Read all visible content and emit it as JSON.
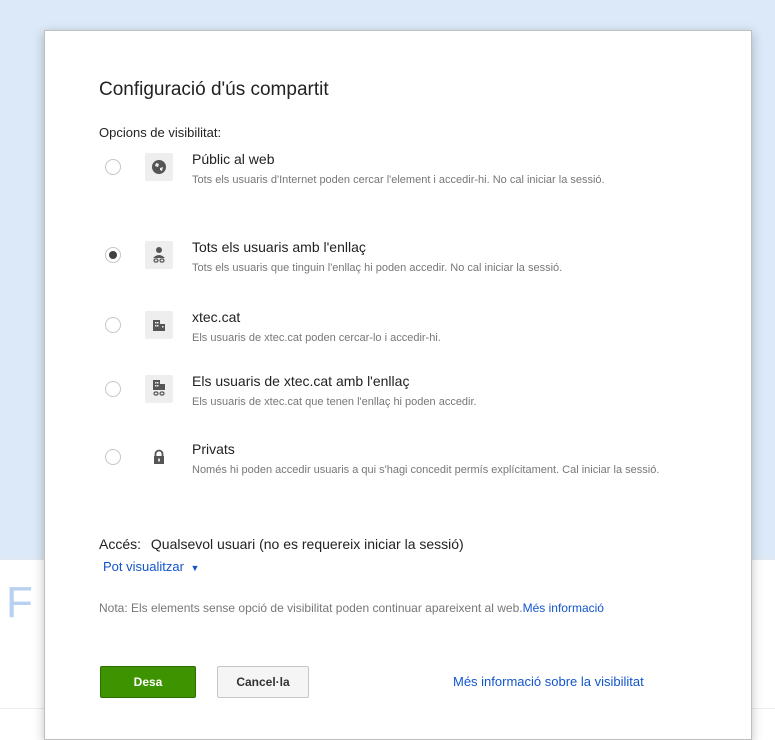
{
  "background": {
    "partial_text": "F"
  },
  "dialog": {
    "title": "Configuració d'ús compartit",
    "visibility_label": "Opcions de visibilitat:",
    "options": [
      {
        "icon": "globe-icon",
        "title": "Públic al web",
        "description": "Tots els usuaris d'Internet poden cercar l'element i accedir-hi. No cal iniciar la sessió.",
        "selected": false
      },
      {
        "icon": "person-link-icon",
        "title": "Tots els usuaris amb l'enllaç",
        "description": "Tots els usuaris que tinguin l'enllaç hi poden accedir. No cal iniciar la sessió.",
        "selected": true
      },
      {
        "icon": "building-icon",
        "title": "xtec.cat",
        "description": "Els usuaris de xtec.cat poden cercar-lo i accedir-hi.",
        "selected": false
      },
      {
        "icon": "building-link-icon",
        "title": "Els usuaris de xtec.cat amb l'enllaç",
        "description": "Els usuaris de xtec.cat que tenen l'enllaç hi poden accedir.",
        "selected": false
      },
      {
        "icon": "lock-icon",
        "title": "Privats",
        "description": "Només hi poden accedir usuaris a qui s'hagi concedit permís explícitament. Cal iniciar la sessió.",
        "selected": false
      }
    ],
    "access_label": "Accés:",
    "access_value": "Qualsevol usuari (no es requereix iniciar la sessió)",
    "permission_link": "Pot visualitzar",
    "note_text": "Nota: Els elements sense opció de visibilitat poden continuar apareixent al web.",
    "note_link": "Més informació",
    "save_label": "Desa",
    "cancel_label": "Cancel·la",
    "more_visibility_link": "Més informació sobre la visibilitat"
  },
  "colors": {
    "save_button": "#3d9400",
    "link": "#1155cc",
    "backdrop": "#dbe9f8"
  }
}
